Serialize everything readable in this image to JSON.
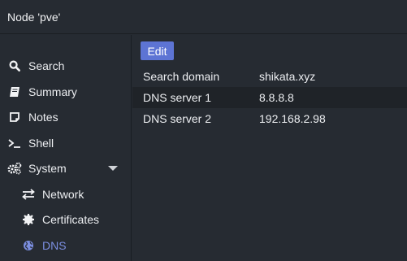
{
  "header": {
    "title": "Node 'pve'"
  },
  "sidebar": {
    "items": [
      {
        "label": "Search",
        "icon": "search-icon"
      },
      {
        "label": "Summary",
        "icon": "book-icon"
      },
      {
        "label": "Notes",
        "icon": "note-icon"
      },
      {
        "label": "Shell",
        "icon": "terminal-icon"
      },
      {
        "label": "System",
        "icon": "gears-icon",
        "expanded": true
      },
      {
        "label": "Network",
        "icon": "exchange-icon"
      },
      {
        "label": "Certificates",
        "icon": "certificate-icon"
      },
      {
        "label": "DNS",
        "icon": "globe-icon",
        "active": true
      }
    ]
  },
  "main": {
    "edit_label": "Edit",
    "rows": [
      {
        "key": "Search domain",
        "value": "shikata.xyz"
      },
      {
        "key": "DNS server 1",
        "value": "8.8.8.8"
      },
      {
        "key": "DNS server 2",
        "value": "192.168.2.98"
      }
    ]
  },
  "colors": {
    "background": "#262b32",
    "accent": "#5d74d4",
    "active_text": "#7b8ee0",
    "row_highlight": "#1f2328"
  }
}
